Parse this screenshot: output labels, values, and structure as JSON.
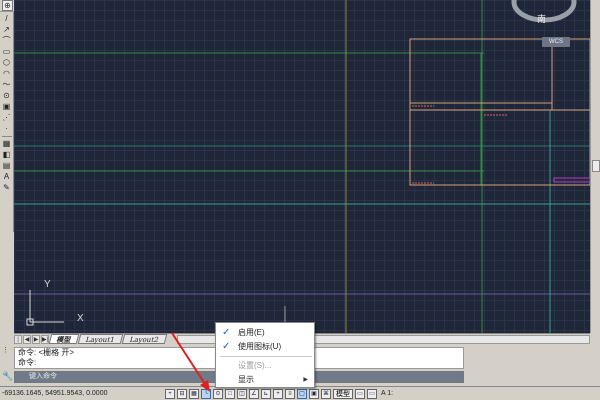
{
  "toolbar": {
    "top_icons": [
      "⊕",
      "↻",
      "▢",
      "⊗"
    ]
  },
  "left_toolbar": {
    "icons": [
      "/",
      "↗",
      "⌒",
      "▭",
      "⬡",
      "◠",
      "〜",
      "⊙",
      "▣",
      "⋰",
      "·",
      "▦",
      "◧",
      "▤",
      "A",
      "✎"
    ]
  },
  "viewcube": {
    "direction_label": "南",
    "wcs_label": "WCS"
  },
  "ucs": {
    "y_label": "Y",
    "x_label": "X"
  },
  "tabs": {
    "nav": [
      "|◀",
      "◀",
      "▶",
      "▶|"
    ],
    "model": "模型",
    "layout1": "Layout1",
    "layout2": "Layout2"
  },
  "command": {
    "line1": "命令: <栅格 开>",
    "line2": "命令:",
    "input_placeholder": "键入命令"
  },
  "status_bar": {
    "coords": "-69136.1645, 54951.9543, 0.0000",
    "model": "模型",
    "scale": "A 1:"
  },
  "context_menu": {
    "items": [
      {
        "label": "启用(E)",
        "checked": "✓"
      },
      {
        "label": "使用图标(U)",
        "checked": "✓"
      },
      {
        "label": "设置(S)...",
        "checked": ""
      },
      {
        "label": "显示",
        "checked": ""
      }
    ]
  },
  "colors": {
    "canvas": "#1f2637",
    "grid": "#2a3349",
    "green_line": "#2f8f3a",
    "yellow_line": "#8a8a2a",
    "orange_rect": "#d9a07a",
    "magenta": "#b040c0",
    "cyan_line": "#3aa090",
    "arrow": "#e02020"
  }
}
